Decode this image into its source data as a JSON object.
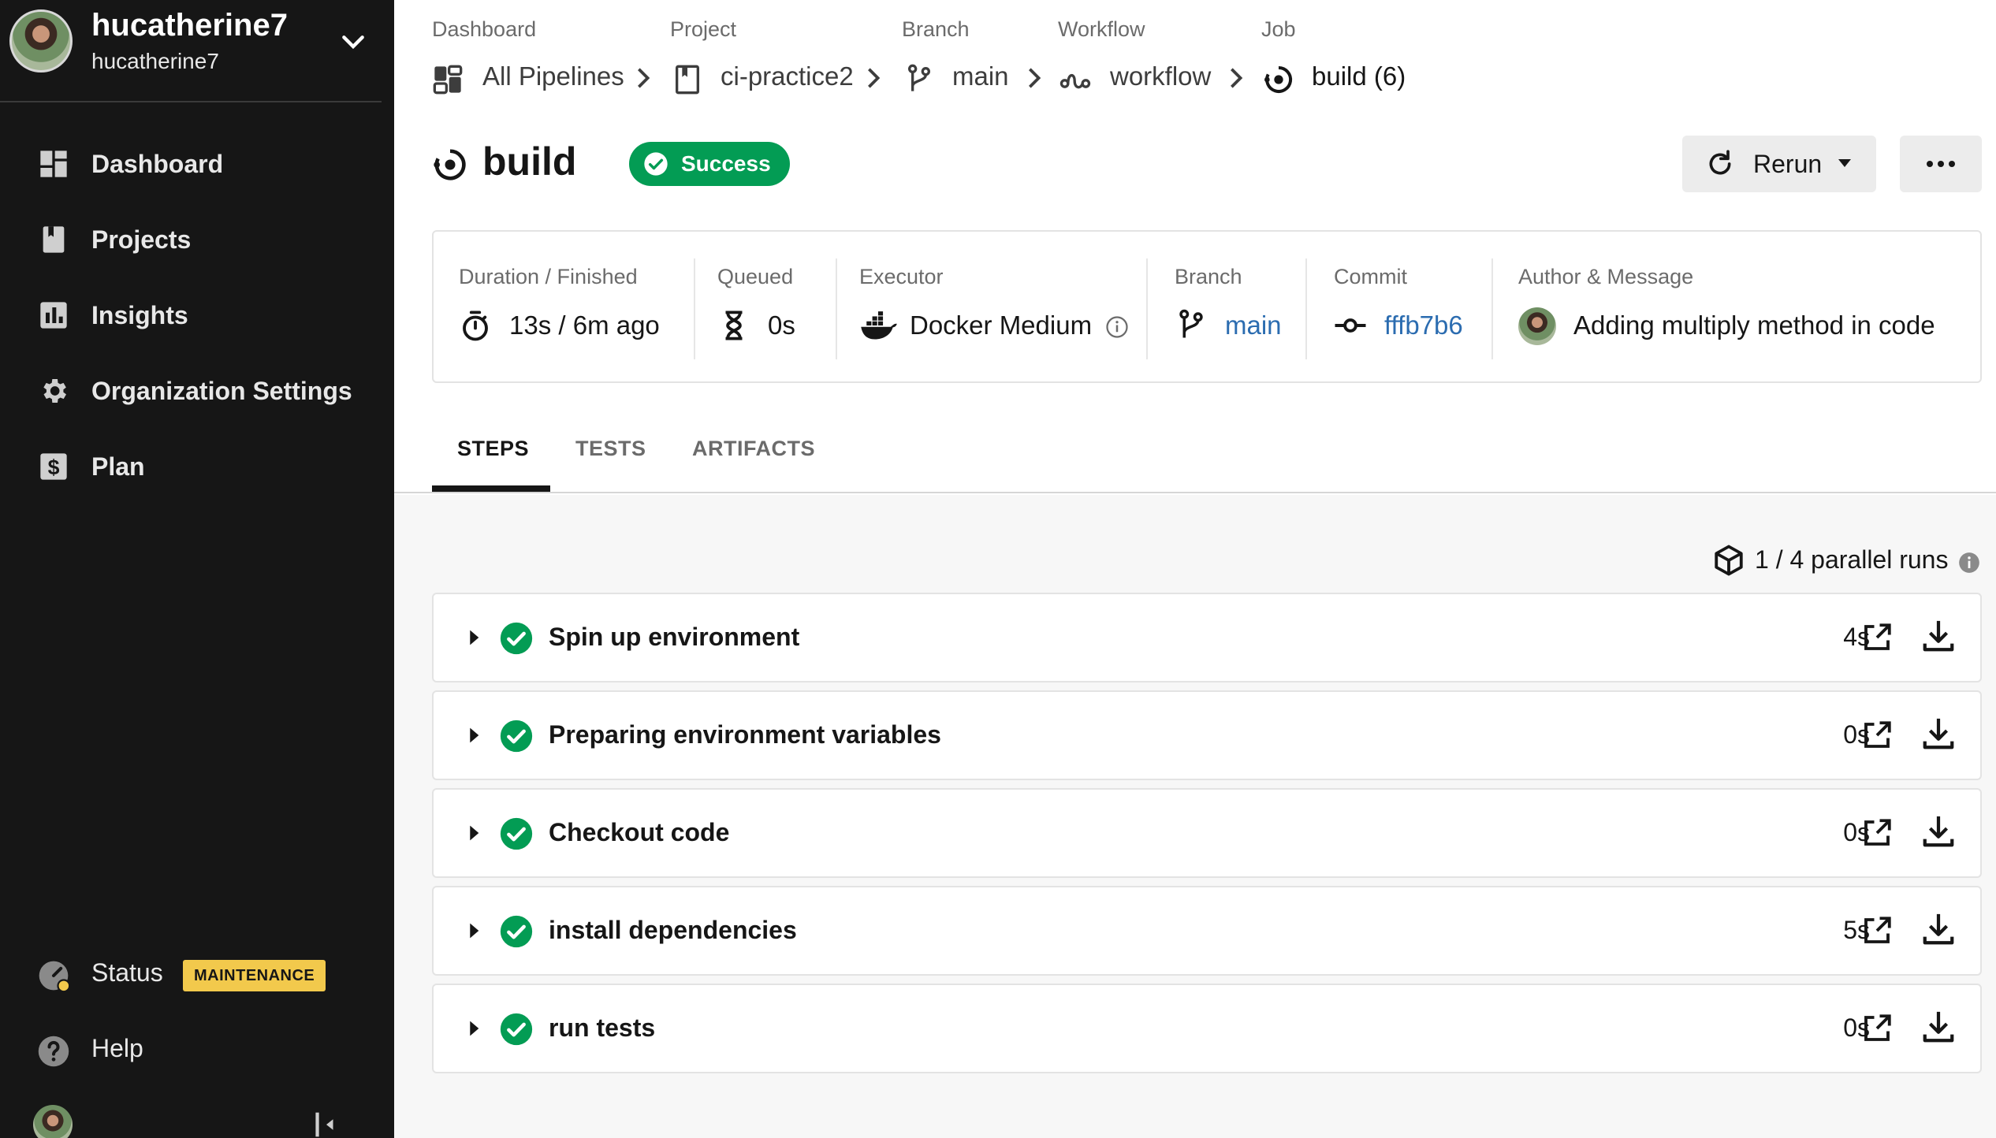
{
  "sidebar": {
    "user": {
      "name": "hucatherine7",
      "org": "hucatherine7"
    },
    "items": [
      {
        "label": "Dashboard",
        "icon": "dashboard-icon"
      },
      {
        "label": "Projects",
        "icon": "projects-icon"
      },
      {
        "label": "Insights",
        "icon": "insights-icon"
      },
      {
        "label": "Organization Settings",
        "icon": "gear-icon"
      },
      {
        "label": "Plan",
        "icon": "dollar-icon"
      }
    ],
    "status": {
      "label": "Status",
      "badge": "MAINTENANCE",
      "badge_color": "#f2c94c"
    },
    "help": {
      "label": "Help"
    }
  },
  "breadcrumb": [
    {
      "label": "Dashboard",
      "value": "All Pipelines",
      "icon": "pipelines-icon"
    },
    {
      "label": "Project",
      "value": "ci-practice2",
      "icon": "project-book-icon"
    },
    {
      "label": "Branch",
      "value": "main",
      "icon": "branch-icon"
    },
    {
      "label": "Workflow",
      "value": "workflow",
      "icon": "workflow-icon"
    },
    {
      "label": "Job",
      "value": "build (6)",
      "icon": "job-icon"
    }
  ],
  "job": {
    "title": "build",
    "status": "Success",
    "status_color": "#039c54",
    "rerun_label": "Rerun"
  },
  "details": {
    "duration": {
      "label": "Duration / Finished",
      "value": "13s / 6m ago"
    },
    "queued": {
      "label": "Queued",
      "value": "0s"
    },
    "executor": {
      "label": "Executor",
      "value": "Docker Medium"
    },
    "branch": {
      "label": "Branch",
      "value": "main"
    },
    "commit": {
      "label": "Commit",
      "value": "fffb7b6"
    },
    "author": {
      "label": "Author & Message",
      "value": "Adding multiply method in code"
    }
  },
  "tabs": [
    {
      "label": "STEPS",
      "active": true
    },
    {
      "label": "TESTS",
      "active": false
    },
    {
      "label": "ARTIFACTS",
      "active": false
    }
  ],
  "parallel_runs": "1 / 4 parallel runs",
  "steps": [
    {
      "name": "Spin up environment",
      "duration": "4s"
    },
    {
      "name": "Preparing environment variables",
      "duration": "0s"
    },
    {
      "name": "Checkout code",
      "duration": "0s"
    },
    {
      "name": "install dependencies",
      "duration": "5s"
    },
    {
      "name": "run tests",
      "duration": "0s"
    }
  ],
  "colors": {
    "sidebar_bg": "#161616",
    "link": "#2b6cb0",
    "success": "#039c54"
  }
}
